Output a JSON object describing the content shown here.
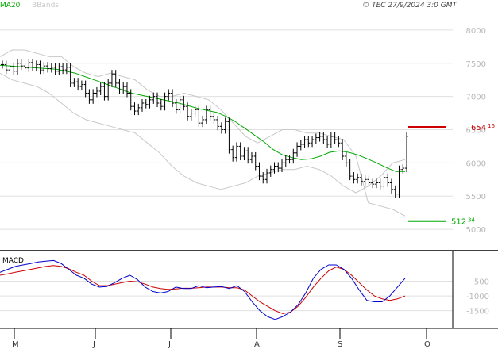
{
  "header": {
    "legend_ma": "MA20",
    "legend_bb": "BBands",
    "copyright": "© TEC 27/9/2024 3:0 GMT"
  },
  "colors": {
    "price": "#000000",
    "ma": "#00aa00",
    "bbands": "#c8c8c8",
    "grid": "#e0e0e0",
    "resistance": "#cc0000",
    "support": "#00aa00",
    "macd": "#0000cc",
    "signal": "#cc0000",
    "axis_text": "#b8b8b8"
  },
  "chart_data": [
    {
      "type": "ohlc",
      "title": "",
      "ylim": [
        4750,
        8250
      ],
      "y_ticks": [
        5000,
        5500,
        6000,
        6500,
        7000,
        7500,
        8000
      ],
      "y_tick_labels": [
        "5000",
        "5500",
        "6000",
        "6500",
        "7000",
        "7500",
        "8000"
      ],
      "x_month_labels": [
        "M",
        "J",
        "J",
        "A",
        "S",
        "O"
      ],
      "resistance": {
        "value": 6541.6,
        "label_main": "654",
        "label_sup": "16"
      },
      "support": {
        "value": 5123.4,
        "label_main": "512",
        "label_sup": "34"
      },
      "series": [
        {
          "name": "Price",
          "values": [
            7480,
            7400,
            7450,
            7380,
            7500,
            7460,
            7430,
            7510,
            7440,
            7480,
            7400,
            7460,
            7420,
            7440,
            7380,
            7450,
            7400,
            7440,
            7200,
            7220,
            7150,
            7180,
            7050,
            6950,
            7050,
            7080,
            7150,
            7000,
            7200,
            7340,
            7200,
            7100,
            7150,
            7050,
            6850,
            6780,
            6830,
            6900,
            6880,
            6950,
            7000,
            6900,
            6850,
            7000,
            7050,
            6900,
            6800,
            6950,
            6850,
            6700,
            6750,
            6800,
            6600,
            6650,
            6800,
            6700,
            6650,
            6550,
            6500,
            6620,
            6200,
            6080,
            6250,
            6100,
            6180,
            6050,
            6100,
            5950,
            5800,
            5750,
            5850,
            5900,
            5950,
            5920,
            6000,
            6050,
            6050,
            6150,
            6250,
            6280,
            6350,
            6300,
            6350,
            6380,
            6400,
            6350,
            6280,
            6400,
            6350,
            6300,
            6100,
            6000,
            5800,
            5750,
            5780,
            5720,
            5750,
            5700,
            5680,
            5700,
            5650,
            5780,
            5700,
            5600,
            5530,
            5900,
            5920,
            6400
          ]
        },
        {
          "name": "MA20",
          "values": [
            7470,
            7460,
            7450,
            7440,
            7430,
            7420,
            7410,
            7380,
            7350,
            7300,
            7250,
            7200,
            7150,
            7100,
            7050,
            7020,
            6990,
            6960,
            6930,
            6900,
            6860,
            6820,
            6790,
            6760,
            6700,
            6620,
            6520,
            6420,
            6320,
            6200,
            6120,
            6080,
            6050,
            6060,
            6100,
            6160,
            6180,
            6160,
            6120,
            6060,
            6000,
            5930,
            5870,
            5870
          ]
        },
        {
          "name": "BBands",
          "values": [
            7600,
            7700,
            7700,
            7650,
            7600,
            7600,
            7450,
            7350,
            7300,
            7350,
            7300,
            7250,
            7100,
            7000,
            7000,
            7050,
            7000,
            6950,
            6800,
            6600,
            6400,
            6300,
            6400,
            6500,
            6500,
            6450,
            6450,
            6400,
            6350,
            6100,
            5400,
            5350,
            5300,
            5200
          ]
        },
        {
          "name": "BBands",
          "values": [
            7350,
            7250,
            7200,
            7150,
            7050,
            6900,
            6750,
            6650,
            6600,
            6550,
            6500,
            6450,
            6300,
            6150,
            5950,
            5800,
            5700,
            5650,
            5600,
            5650,
            5700,
            5800,
            5850,
            5900,
            5900,
            5950,
            5900,
            5800,
            5650,
            5550,
            5650,
            5800,
            6000,
            6050
          ]
        }
      ]
    },
    {
      "type": "line",
      "title": "MACD",
      "ylim": [
        -2100,
        400
      ],
      "y_ticks": [
        -500,
        -1000,
        -1500
      ],
      "y_tick_labels": [
        "-500",
        "-1000",
        "-1500"
      ],
      "series": [
        {
          "name": "MACD",
          "values": [
            -200,
            -100,
            0,
            50,
            100,
            150,
            180,
            200,
            100,
            -100,
            -300,
            -400,
            -600,
            -700,
            -680,
            -550,
            -400,
            -300,
            -450,
            -700,
            -850,
            -900,
            -850,
            -700,
            -750,
            -750,
            -650,
            -720,
            -700,
            -680,
            -750,
            -650,
            -850,
            -1200,
            -1500,
            -1700,
            -1800,
            -1700,
            -1550,
            -1300,
            -900,
            -400,
            -100,
            50,
            50,
            -100,
            -400,
            -800,
            -1150,
            -1200,
            -1200,
            -1000,
            -700,
            -400
          ]
        },
        {
          "name": "Signal",
          "values": [
            -300,
            -250,
            -200,
            -150,
            -100,
            -50,
            0,
            30,
            0,
            -80,
            -200,
            -300,
            -500,
            -650,
            -650,
            -600,
            -550,
            -500,
            -520,
            -600,
            -700,
            -750,
            -780,
            -760,
            -740,
            -740,
            -720,
            -700,
            -700,
            -700,
            -720,
            -720,
            -800,
            -1000,
            -1200,
            -1350,
            -1500,
            -1600,
            -1550,
            -1350,
            -1050,
            -700,
            -400,
            -150,
            -20,
            -100,
            -300,
            -550,
            -800,
            -1000,
            -1100,
            -1150,
            -1100,
            -1000
          ]
        }
      ]
    }
  ]
}
